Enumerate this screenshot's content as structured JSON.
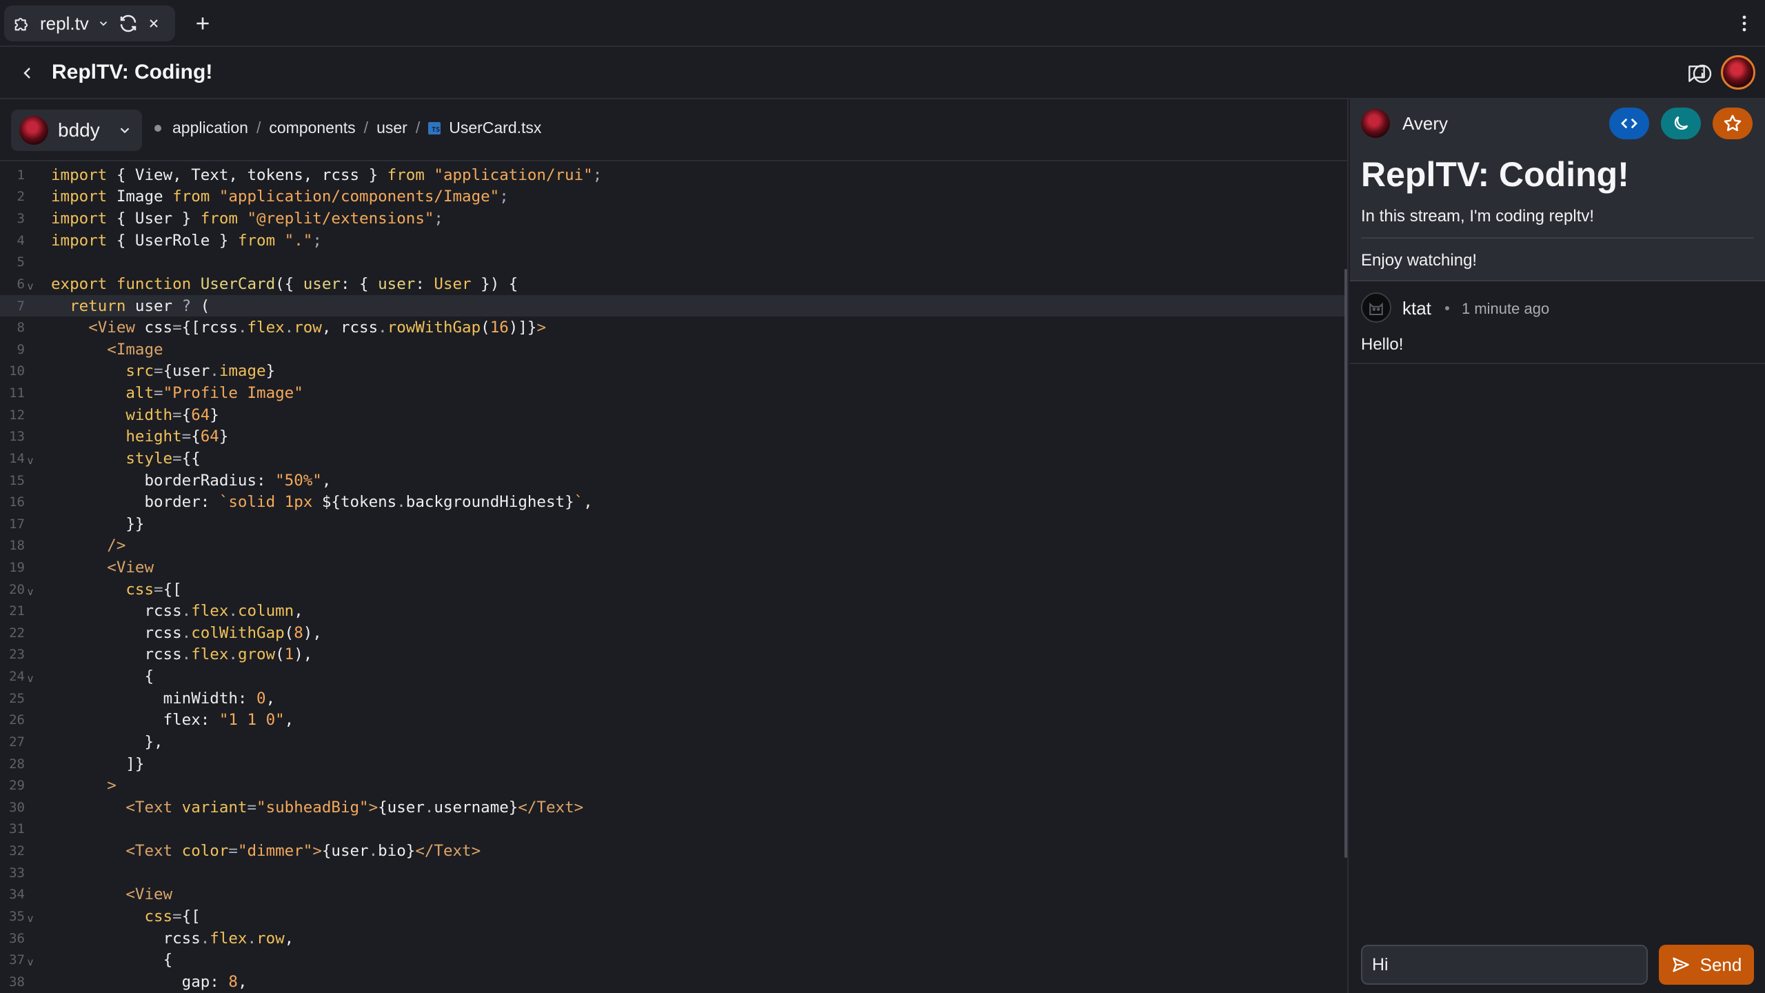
{
  "browser": {
    "tab_title": "repl.tv"
  },
  "header": {
    "title": "ReplTV: Coding!"
  },
  "editor": {
    "user": "bddy",
    "breadcrumb": [
      "application",
      "components",
      "user"
    ],
    "file": "UserCard.tsx",
    "file_icon": "TS",
    "active_line": 7,
    "lines": [
      [
        [
          "k",
          "import "
        ],
        [
          "",
          "{ View, Text, tokens, rcss } "
        ],
        [
          "k",
          "from "
        ],
        [
          "s",
          "\"application/rui\""
        ],
        [
          "p",
          ";"
        ]
      ],
      [
        [
          "k",
          "import "
        ],
        [
          "",
          "Image "
        ],
        [
          "k",
          "from "
        ],
        [
          "s",
          "\"application/components/Image\""
        ],
        [
          "p",
          ";"
        ]
      ],
      [
        [
          "k",
          "import "
        ],
        [
          "",
          "{ User } "
        ],
        [
          "k",
          "from "
        ],
        [
          "s",
          "\"@replit/extensions\""
        ],
        [
          "p",
          ";"
        ]
      ],
      [
        [
          "k",
          "import "
        ],
        [
          "",
          "{ UserRole } "
        ],
        [
          "k",
          "from "
        ],
        [
          "s",
          "\".\""
        ],
        [
          "p",
          ";"
        ]
      ],
      [],
      [
        [
          "k",
          "export function "
        ],
        [
          "f",
          "UserCard"
        ],
        [
          "",
          "({ "
        ],
        [
          "f",
          "user"
        ],
        [
          "",
          ": { "
        ],
        [
          "f",
          "user"
        ],
        [
          "",
          ": "
        ],
        [
          "t",
          "User"
        ],
        [
          "",
          " }) {"
        ]
      ],
      [
        [
          "",
          "  "
        ],
        [
          "k",
          "return "
        ],
        [
          "",
          "user "
        ],
        [
          "p",
          "? "
        ],
        [
          "",
          "("
        ]
      ],
      [
        [
          "",
          "    "
        ],
        [
          "tag",
          "<View "
        ],
        [
          "",
          "css"
        ],
        [
          "p",
          "="
        ],
        [
          "",
          "{[rcss"
        ],
        [
          "p",
          "."
        ],
        [
          "m",
          "flex"
        ],
        [
          "p",
          "."
        ],
        [
          "m",
          "row"
        ],
        [
          "",
          ", rcss"
        ],
        [
          "p",
          "."
        ],
        [
          "m",
          "rowWithGap"
        ],
        [
          "",
          "("
        ],
        [
          "n",
          "16"
        ],
        [
          "",
          ")]}"
        ],
        [
          "tag",
          ">"
        ]
      ],
      [
        [
          "",
          "      "
        ],
        [
          "tag",
          "<Image"
        ]
      ],
      [
        [
          "",
          "        "
        ],
        [
          "m",
          "src"
        ],
        [
          "p",
          "="
        ],
        [
          "",
          "{user"
        ],
        [
          "p",
          "."
        ],
        [
          "m",
          "image"
        ],
        [
          "",
          "}"
        ]
      ],
      [
        [
          "",
          "        "
        ],
        [
          "m",
          "alt"
        ],
        [
          "p",
          "="
        ],
        [
          "s",
          "\"Profile Image\""
        ]
      ],
      [
        [
          "",
          "        "
        ],
        [
          "m",
          "width"
        ],
        [
          "p",
          "="
        ],
        [
          "",
          "{"
        ],
        [
          "n",
          "64"
        ],
        [
          "",
          "}"
        ]
      ],
      [
        [
          "",
          "        "
        ],
        [
          "m",
          "height"
        ],
        [
          "p",
          "="
        ],
        [
          "",
          "{"
        ],
        [
          "n",
          "64"
        ],
        [
          "",
          "}"
        ]
      ],
      [
        [
          "",
          "        "
        ],
        [
          "m",
          "style"
        ],
        [
          "p",
          "="
        ],
        [
          "",
          "{{"
        ]
      ],
      [
        [
          "",
          "          "
        ],
        [
          "",
          "borderRadius: "
        ],
        [
          "s",
          "\"50%\""
        ],
        [
          "",
          ","
        ]
      ],
      [
        [
          "",
          "          "
        ],
        [
          "",
          "border: "
        ],
        [
          "s",
          "`solid 1px "
        ],
        [
          "",
          "${tokens"
        ],
        [
          "p",
          "."
        ],
        [
          "",
          "backgroundHighest}"
        ],
        [
          "s",
          "`"
        ],
        [
          "",
          ","
        ]
      ],
      [
        [
          "",
          "        "
        ],
        [
          "",
          "}}"
        ]
      ],
      [
        [
          "",
          "      "
        ],
        [
          "tag",
          "/>"
        ]
      ],
      [
        [
          "",
          "      "
        ],
        [
          "tag",
          "<View"
        ]
      ],
      [
        [
          "",
          "        "
        ],
        [
          "m",
          "css"
        ],
        [
          "p",
          "="
        ],
        [
          "",
          "{["
        ]
      ],
      [
        [
          "",
          "          "
        ],
        [
          "",
          "rcss"
        ],
        [
          "p",
          "."
        ],
        [
          "m",
          "flex"
        ],
        [
          "p",
          "."
        ],
        [
          "m",
          "column"
        ],
        [
          "",
          ","
        ]
      ],
      [
        [
          "",
          "          "
        ],
        [
          "",
          "rcss"
        ],
        [
          "p",
          "."
        ],
        [
          "m",
          "colWithGap"
        ],
        [
          "",
          "("
        ],
        [
          "n",
          "8"
        ],
        [
          "",
          "),"
        ]
      ],
      [
        [
          "",
          "          "
        ],
        [
          "",
          "rcss"
        ],
        [
          "p",
          "."
        ],
        [
          "m",
          "flex"
        ],
        [
          "p",
          "."
        ],
        [
          "m",
          "grow"
        ],
        [
          "",
          "("
        ],
        [
          "n",
          "1"
        ],
        [
          "",
          "),"
        ]
      ],
      [
        [
          "",
          "          "
        ],
        [
          "",
          "{"
        ]
      ],
      [
        [
          "",
          "            "
        ],
        [
          "",
          "minWidth: "
        ],
        [
          "n",
          "0"
        ],
        [
          "",
          ","
        ]
      ],
      [
        [
          "",
          "            "
        ],
        [
          "",
          "flex: "
        ],
        [
          "s",
          "\"1 1 0\""
        ],
        [
          "",
          ","
        ]
      ],
      [
        [
          "",
          "          "
        ],
        [
          "",
          "},"
        ]
      ],
      [
        [
          "",
          "        "
        ],
        [
          "",
          "]}"
        ]
      ],
      [
        [
          "",
          "      "
        ],
        [
          "tag",
          ">"
        ]
      ],
      [
        [
          "",
          "        "
        ],
        [
          "tag",
          "<Text "
        ],
        [
          "m",
          "variant"
        ],
        [
          "p",
          "="
        ],
        [
          "s",
          "\"subheadBig\""
        ],
        [
          "tag",
          ">"
        ],
        [
          "",
          "{user"
        ],
        [
          "p",
          "."
        ],
        [
          "",
          "username}"
        ],
        [
          "tag",
          "</Text>"
        ]
      ],
      [],
      [
        [
          "",
          "        "
        ],
        [
          "tag",
          "<Text "
        ],
        [
          "m",
          "color"
        ],
        [
          "p",
          "="
        ],
        [
          "s",
          "\"dimmer\""
        ],
        [
          "tag",
          ">"
        ],
        [
          "",
          "{user"
        ],
        [
          "p",
          "."
        ],
        [
          "",
          "bio}"
        ],
        [
          "tag",
          "</Text>"
        ]
      ],
      [],
      [
        [
          "",
          "        "
        ],
        [
          "tag",
          "<View"
        ]
      ],
      [
        [
          "",
          "          "
        ],
        [
          "m",
          "css"
        ],
        [
          "p",
          "="
        ],
        [
          "",
          "{["
        ]
      ],
      [
        [
          "",
          "            "
        ],
        [
          "",
          "rcss"
        ],
        [
          "p",
          "."
        ],
        [
          "m",
          "flex"
        ],
        [
          "p",
          "."
        ],
        [
          "m",
          "row"
        ],
        [
          "",
          ","
        ]
      ],
      [
        [
          "",
          "            "
        ],
        [
          "",
          "{"
        ]
      ],
      [
        [
          "",
          "              "
        ],
        [
          "",
          "gap: "
        ],
        [
          "n",
          "8"
        ],
        [
          "",
          ","
        ]
      ]
    ],
    "fold_lines": [
      6,
      14,
      20,
      24,
      35,
      37
    ]
  },
  "panel": {
    "streamer": "Avery",
    "title": "ReplTV: Coding!",
    "description": "In this stream, I'm coding repltv!",
    "description2": "Enjoy watching!",
    "messages": [
      {
        "author": "ktat",
        "time": "1 minute ago",
        "body": "Hello!"
      }
    ],
    "input_value": "Hi",
    "send_label": "Send",
    "colors": {
      "code_pill": "#0b5db8",
      "theme_pill": "#0a7b84",
      "star_pill": "#c4570a"
    }
  }
}
